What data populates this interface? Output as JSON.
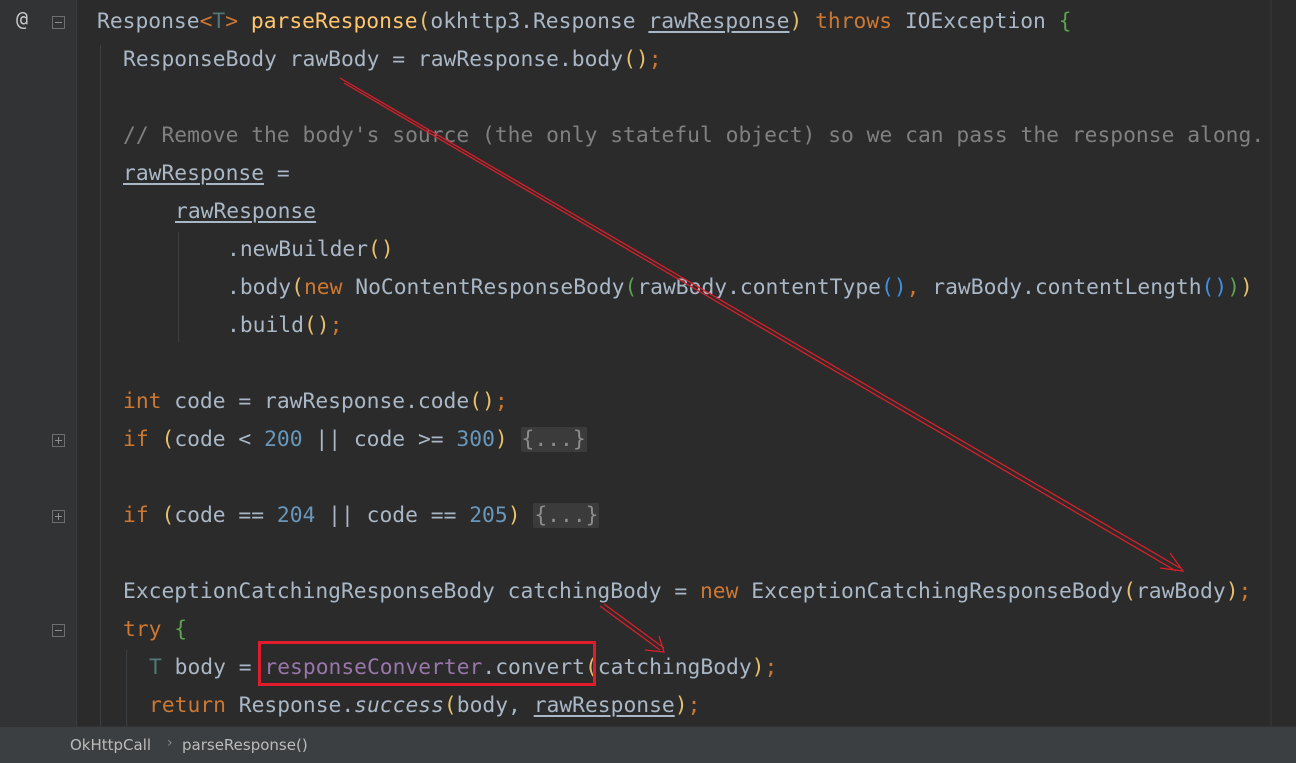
{
  "editor": {
    "lines": {
      "l1": {
        "return_type": "Response",
        "tp_open": "<",
        "tp": "T",
        "tp_close": ">",
        "name": "parseResponse",
        "paren_open": "(",
        "param_type": "okhttp3.Response ",
        "param": "rawResponse",
        "paren_close": ")",
        "throws": " throws ",
        "exc": "IOException ",
        "brace": "{"
      },
      "l2": {
        "pre": "ResponseBody rawBody = rawResponse.",
        "call": "body",
        "parens": "()",
        "semi": ";"
      },
      "l3": {
        "comment": "// Remove the body's source (the only stateful object) so we can pass the response along."
      },
      "l4": {
        "var": "rawResponse",
        "rest": " ="
      },
      "l5": {
        "var": "rawResponse"
      },
      "l6": {
        "dot": ".",
        "call": "newBuilder",
        "parens": "()"
      },
      "l7": {
        "dot": ".",
        "call": "body",
        "open": "(",
        "new": "new ",
        "cls": "NoContentResponseBody",
        "open2": "(",
        "arg1": "rawBody.contentType",
        "p1": "()",
        "comma": ", ",
        "arg2": "rawBody.contentLength",
        "p2": "()",
        "close2": ")",
        "close": ")"
      },
      "l8": {
        "dot": ".",
        "call": "build",
        "parens": "()",
        "semi": ";"
      },
      "l9": {
        "kw": "int",
        "rest": " code = rawResponse.code",
        "parens": "()",
        "semi": ";"
      },
      "l10": {
        "kw": "if",
        "space": " ",
        "open": "(",
        "a": "code < ",
        "n1": "200",
        "b": " || code >= ",
        "n2": "300",
        "close": ")",
        "fold": "{...}"
      },
      "l11": {
        "kw": "if",
        "space": " ",
        "open": "(",
        "a": "code == ",
        "n1": "204",
        "b": " || code == ",
        "n2": "205",
        "close": ")",
        "fold": "{...}"
      },
      "l12": {
        "a": "ExceptionCatchingResponseBody catchingBody = ",
        "new": "new ",
        "b": "ExceptionCatchingResponseBody",
        "open": "(",
        "arg": "rawBody",
        "close": ")",
        "semi": ";"
      },
      "l13": {
        "kw": "try",
        "brace": "{"
      },
      "l14": {
        "tp": "T",
        "a": " body = ",
        "field": "responseConverter",
        "b": ".convert",
        "open": "(",
        "arg": "catchingBody",
        "close": ")",
        "semi": ";"
      },
      "l15": {
        "kw": "return",
        "a": " Response.",
        "method": "success",
        "open": "(",
        "b": "body, ",
        "arg": "rawResponse",
        "close": ")",
        "semi": ";"
      }
    }
  },
  "gutter": {
    "annotation_icon": "@"
  },
  "breadcrumb": {
    "item1": "OkHttpCall",
    "separator": "›",
    "item2": "parseResponse()"
  },
  "annotations": {
    "arrow_color": "#d91f2a",
    "box_color": "#e01b2c"
  }
}
